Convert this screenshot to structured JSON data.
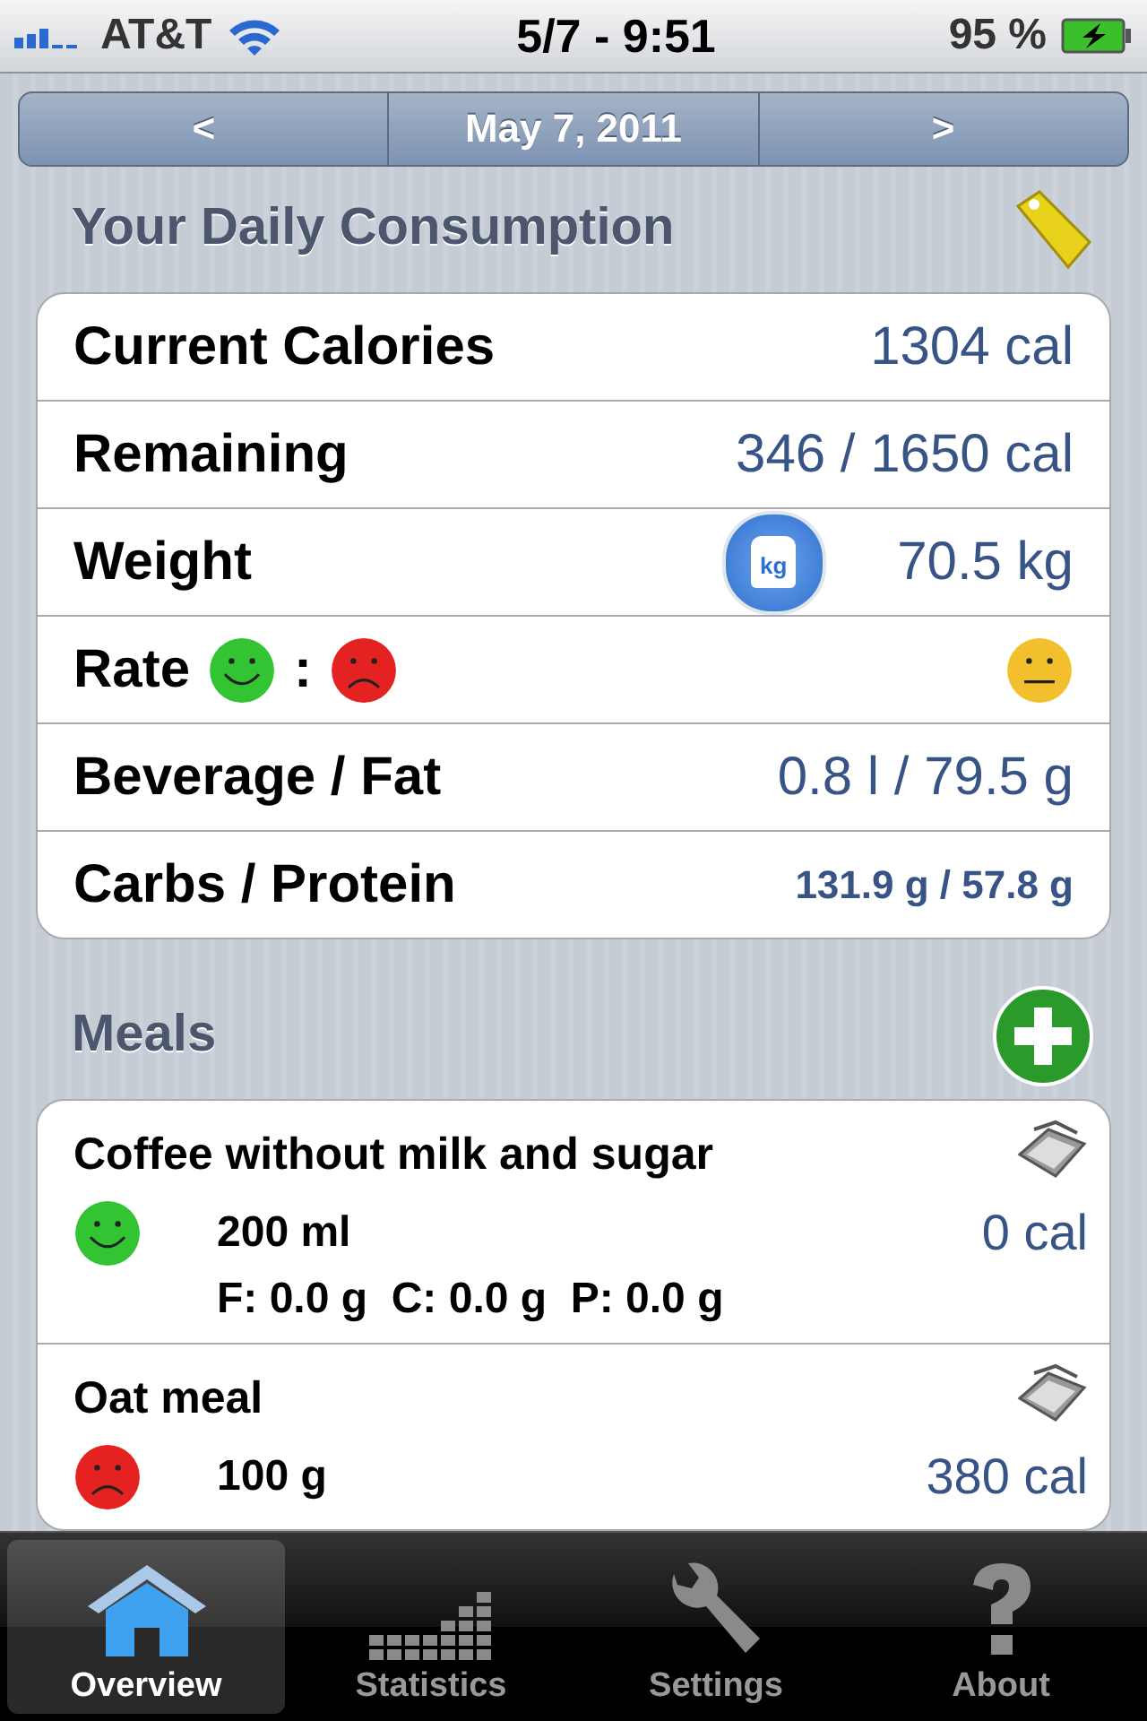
{
  "status_bar": {
    "carrier": "AT&T",
    "time": "5/7 - 9:51",
    "battery": "95 %"
  },
  "date_nav": {
    "prev": "<",
    "date": "May 7, 2011",
    "next": ">"
  },
  "consumption": {
    "title": "Your Daily Consumption",
    "rows": [
      {
        "kind": "text",
        "label": "Current Calories",
        "value": "1304 cal"
      },
      {
        "kind": "text",
        "label": "Remaining",
        "value": "346 / 1650 cal"
      },
      {
        "kind": "weight",
        "label": "Weight",
        "icon_label": "kg",
        "value": "70.5 kg"
      },
      {
        "kind": "rate",
        "label": "Rate",
        "separator": ":",
        "faces": [
          {
            "kind": "happy"
          },
          {
            "kind": "sad"
          }
        ],
        "status": {
          "kind": "neutral"
        }
      },
      {
        "kind": "text",
        "label": "Beverage / Fat",
        "value": "0.8 l / 79.5 g"
      },
      {
        "kind": "small",
        "label": "Carbs / Protein",
        "value": "131.9 g / 57.8 g"
      }
    ]
  },
  "meals": {
    "title": "Meals",
    "items": [
      {
        "name": "Coffee without milk and sugar",
        "face": {
          "kind": "happy"
        },
        "amount": "200 ml",
        "nutrients": "F: 0.0 g  C: 0.0 g  P: 0.0 g",
        "calories": "0 cal"
      },
      {
        "name": "Oat meal",
        "face": {
          "kind": "sad"
        },
        "amount": "100 g",
        "calories": "380 cal"
      }
    ]
  },
  "tabs": [
    {
      "label": "Overview",
      "selected": true
    },
    {
      "label": "Statistics",
      "selected": false
    },
    {
      "label": "Settings",
      "selected": false
    },
    {
      "label": "About",
      "selected": false
    }
  ]
}
